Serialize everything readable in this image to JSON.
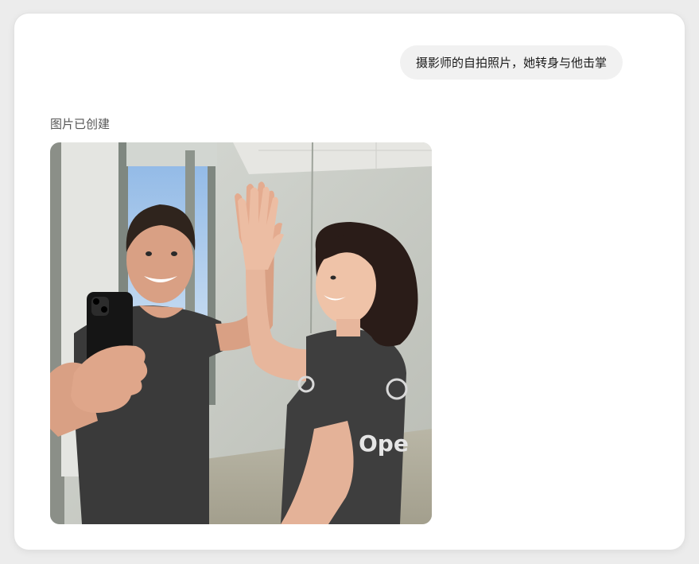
{
  "chat": {
    "user_message": "摄影师的自拍照片，她转身与他击掌",
    "status_label": "图片已创建"
  },
  "image": {
    "shirt_logo_text": "Ope"
  },
  "colors": {
    "page_bg": "#ececec",
    "card_bg": "#ffffff",
    "bubble_bg": "#f1f1f1",
    "shirt_dark": "#3a3a3a",
    "wall": "#cfd2cc",
    "sky": "#9fc3e8"
  }
}
